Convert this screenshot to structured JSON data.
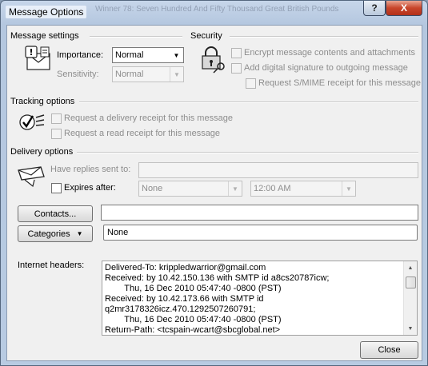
{
  "window": {
    "title": "Message Options",
    "background_title": "Winner 78: Seven Hundred And Fifty Thousand Great British Pounds",
    "help_label": "?",
    "close_glyph": "X"
  },
  "message_settings": {
    "title": "Message settings",
    "importance_label": "Importance:",
    "importance_value": "Normal",
    "sensitivity_label": "Sensitivity:",
    "sensitivity_value": "Normal"
  },
  "security": {
    "title": "Security",
    "encrypt_label": "Encrypt message contents and attachments",
    "signature_label": "Add digital signature to outgoing message",
    "smime_label": "Request S/MIME receipt for this message"
  },
  "tracking": {
    "title": "Tracking options",
    "delivery_receipt_label": "Request a delivery receipt for this message",
    "read_receipt_label": "Request a read receipt for this message"
  },
  "delivery": {
    "title": "Delivery options",
    "replies_label": "Have replies sent to:",
    "replies_value": "",
    "expires_label": "Expires after:",
    "expires_date": "None",
    "expires_time": "12:00 AM"
  },
  "contacts": {
    "button_label": "Contacts...",
    "value": ""
  },
  "categories": {
    "button_label": "Categories",
    "value": "None"
  },
  "internet_headers": {
    "label": "Internet headers:",
    "text": "Delivered-To: krippledwarrior@gmail.com\nReceived: by 10.42.150.136 with SMTP id a8cs20787icw;\n        Thu, 16 Dec 2010 05:47:40 -0800 (PST)\nReceived: by 10.42.173.66 with SMTP id\nq2mr3178326icz.470.1292507260791;\n        Thu, 16 Dec 2010 05:47:40 -0800 (PST)\nReturn-Path: <tcspain-wcart@sbcglobal.net>"
  },
  "footer": {
    "close_label": "Close"
  }
}
